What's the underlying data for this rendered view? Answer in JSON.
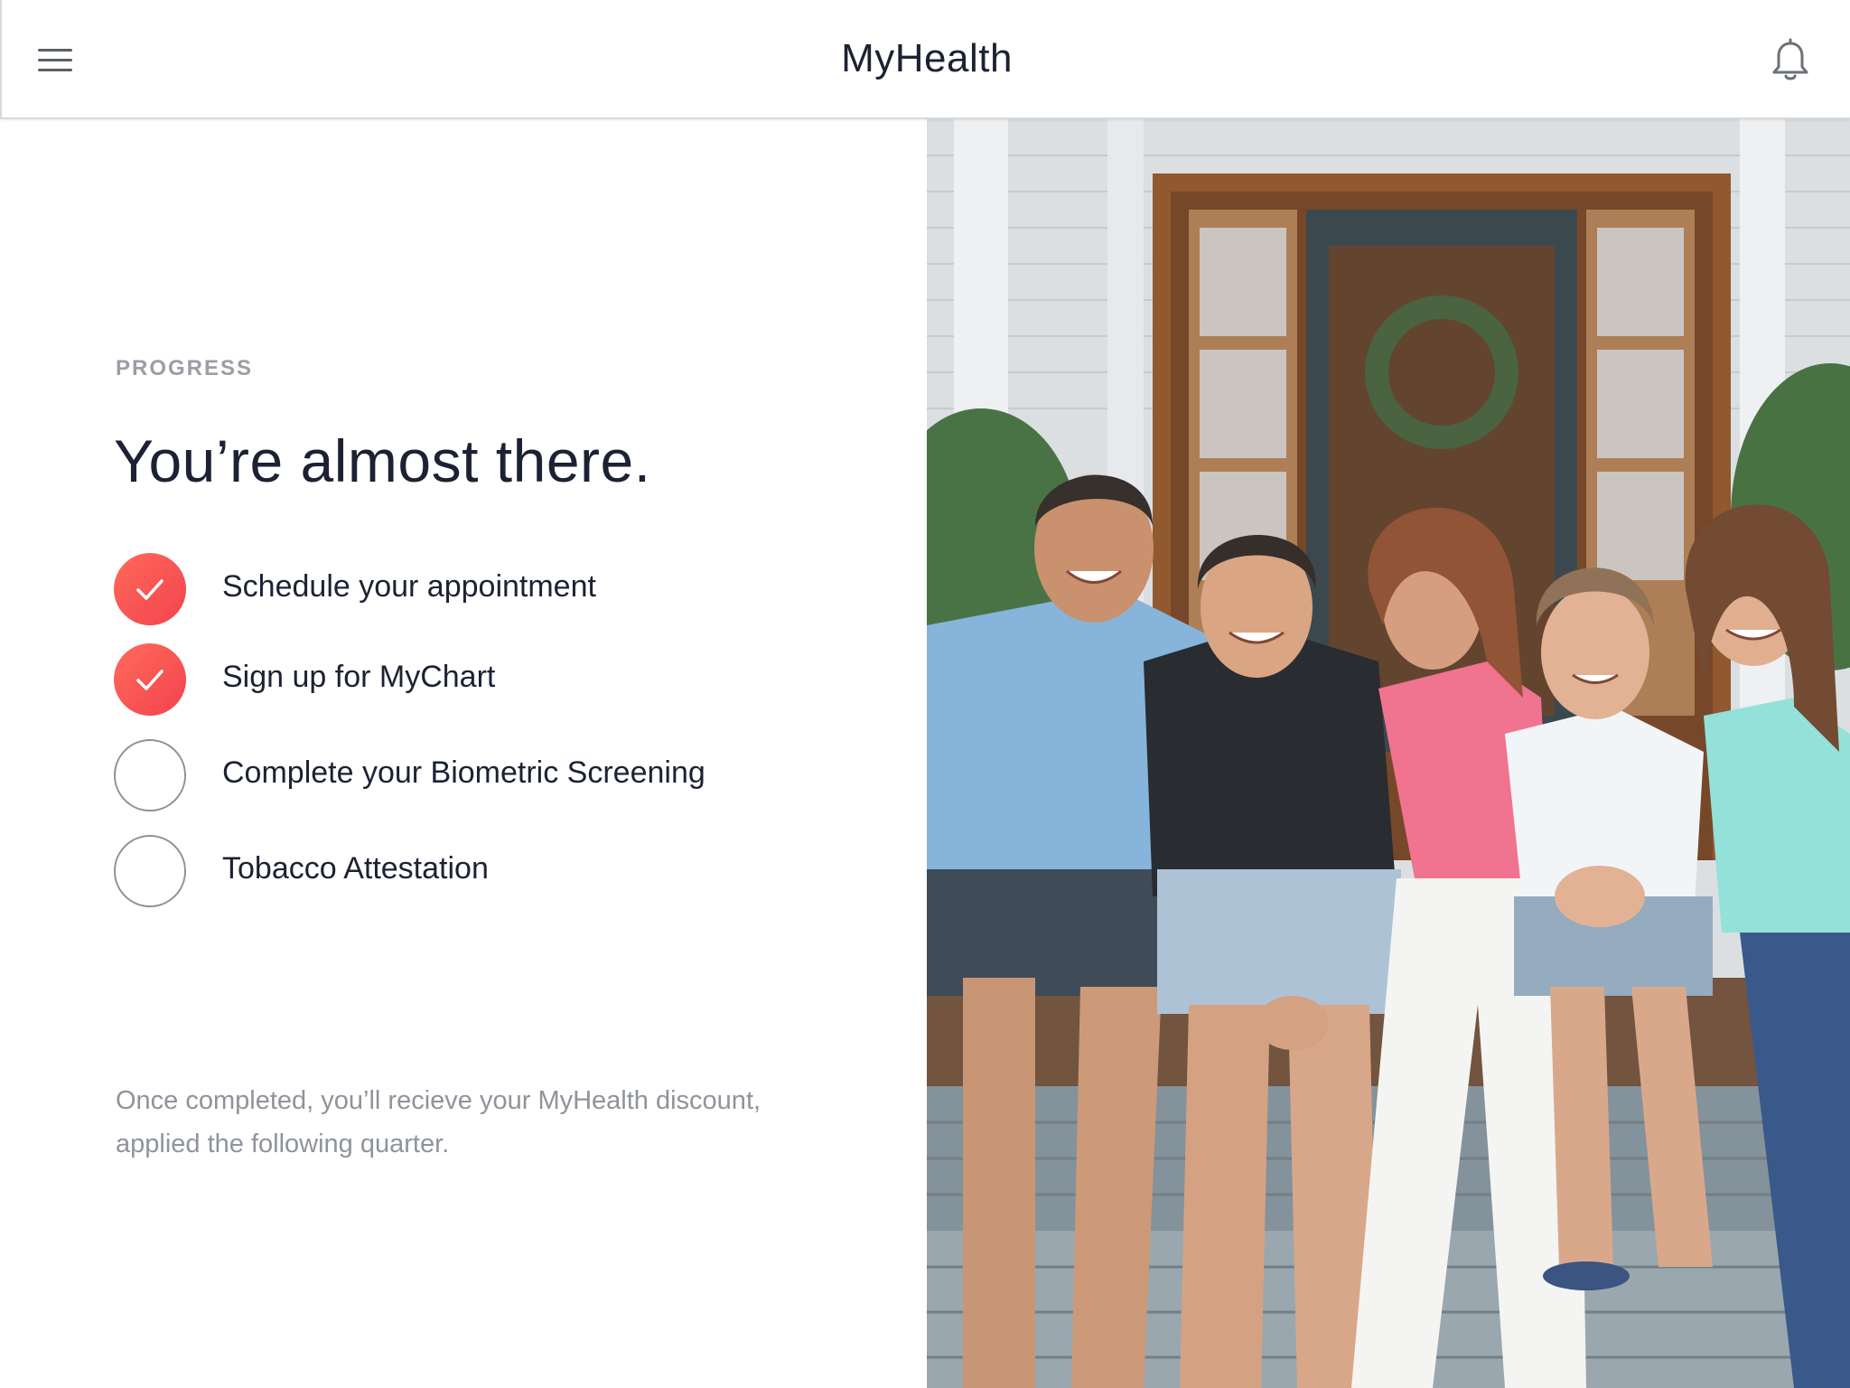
{
  "header": {
    "title": "MyHealth",
    "menu_icon": "hamburger-menu-icon",
    "notification_icon": "bell-icon",
    "notification_dot_color": "#f0424c"
  },
  "progress": {
    "eyebrow": "PROGRESS",
    "headline": "You’re almost there.",
    "tasks": [
      {
        "label": "Schedule your appointment",
        "completed": true
      },
      {
        "label": "Sign up for MyChart",
        "completed": true
      },
      {
        "label": "Complete your Biometric Screening",
        "completed": false
      },
      {
        "label": "Tobacco Attestation",
        "completed": false
      }
    ],
    "note": "Once completed, you’ll recieve your MyHealth discount, applied the following quarter."
  },
  "colors": {
    "accent": "#f2434d",
    "text": "#1c2233",
    "muted": "#8f939b"
  }
}
